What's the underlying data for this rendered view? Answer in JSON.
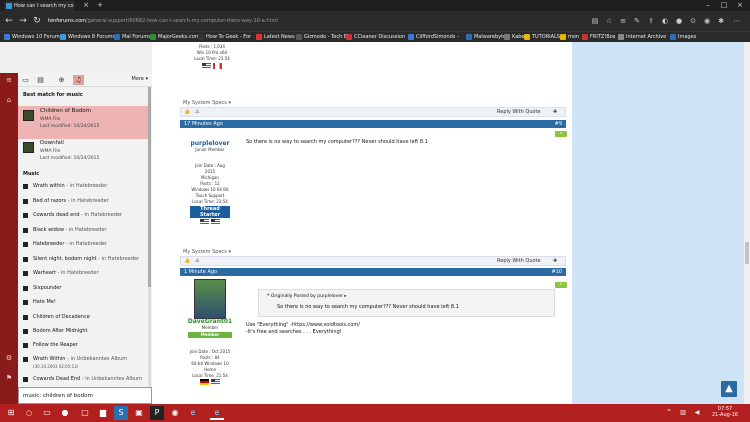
{
  "browser": {
    "tab_title": "How can I search my co",
    "url_domain": "tenforums.com",
    "url_path": "/general-support/60682-how-can-i-search-my-computer-there-way-10-a.html",
    "favorites": [
      {
        "label": "Windows 10 Forums",
        "color": "#3a7bd5"
      },
      {
        "label": "Windows 8 Forums",
        "color": "#3a9bdc"
      },
      {
        "label": "Mal Forums",
        "color": "#2a6fb0"
      },
      {
        "label": "MajorGeeks.com",
        "color": "#2f8f2f"
      },
      {
        "label": "How To Geek - For",
        "color": "#333333"
      },
      {
        "label": "Latest News",
        "color": "#d33"
      },
      {
        "label": "Gizmodo - Tech By",
        "color": "#555"
      },
      {
        "label": "CCleaner Discussion",
        "color": "#c33"
      },
      {
        "label": "CliffordSimonds -",
        "color": "#3a7bd5"
      },
      {
        "label": "Malwarebytes",
        "color": "#2a6fb0"
      },
      {
        "label": "Kabel",
        "color": "#777"
      },
      {
        "label": "TUTORIALS",
        "color": "#e6b800"
      },
      {
        "label": "mon",
        "color": "#e6b800"
      },
      {
        "label": "FRITZ!Box",
        "color": "#c33"
      },
      {
        "label": "Internet Archive",
        "color": "#888"
      },
      {
        "label": "Images",
        "color": "#2a6fb0"
      }
    ]
  },
  "start_menu": {
    "more_label": "More",
    "best_match_heading": "Best match for music",
    "best_matches": [
      {
        "title": "Children of Bodom",
        "type": "WMA File",
        "modified": "Last modified: 10/24/2015",
        "selected": true
      },
      {
        "title": "Downfall",
        "type": "WMA File",
        "modified": "Last modified: 10/24/2015",
        "selected": false
      }
    ],
    "music_heading": "Music",
    "music_items": [
      {
        "title": "Wrath within",
        "album": " - in Hatebreeder"
      },
      {
        "title": "Bed of razors",
        "album": " - in Hatebreeder"
      },
      {
        "title": "Cowards dead end",
        "album": " - in Hatebreeder"
      },
      {
        "title": "Black widow",
        "album": " - in Hatebreeder"
      },
      {
        "title": "Hatebreeder",
        "album": " - in Hatebreeder"
      },
      {
        "title": "Silent night, bodom night",
        "album": " - in Hatebreeder"
      },
      {
        "title": "Warheart",
        "album": " - in Hatebreeder"
      },
      {
        "title": "Sixpounder",
        "album": ""
      },
      {
        "title": "Hate Me!",
        "album": ""
      },
      {
        "title": "Children of Decadence",
        "album": ""
      },
      {
        "title": "Bodom After Midnight",
        "album": ""
      },
      {
        "title": "Follow the Reaper",
        "album": ""
      },
      {
        "title": "Wrath Within",
        "album": " - in Unbekanntes Album"
      },
      {
        "title": "Cowards Dead End",
        "album": " - in Unbekanntes Album"
      }
    ],
    "music_item_dates": [
      "(30.10.2003 02:05:13)"
    ],
    "search_value": "music: children of bodom"
  },
  "forum": {
    "top_user": {
      "posts": "Posts : 1,034",
      "os": "Win 10 Pro x64",
      "local_time": "Local Time: 23:54"
    },
    "specs_label": "My System Specs",
    "reply_label": "Reply With Quote",
    "post9": {
      "time": "17 Minutes Ago",
      "number": "#9",
      "username": "purplelover",
      "title": "Junior Member",
      "join": "Join Date : Aug 2015",
      "location": "Michigan",
      "posts": "Posts : 12",
      "os": "Windows 10 64 Bit Touch Support",
      "local_time": "Local Time: 23:54",
      "badge": "Thread Starter",
      "text": "So there is no way to search my computer??? Never should have left 8.1"
    },
    "post10": {
      "time": "1 Minute Ago",
      "number": "#10",
      "username": "DaveGrant01",
      "title": "Member",
      "rank": "Member",
      "join": "Join Date : Oct 2015",
      "posts": "Posts : 84",
      "os": "64-bit Windows 10 Home",
      "local_time": "Local Time: 21:54",
      "quote_by": "Originally Posted by purplelover",
      "quote_text": "So there is no way to search my computer??? Never should have left 8.1",
      "line1": "Use \"Everything\" -https://www.voidtools.com/",
      "line2": "-It's free and searches . . . Everything!"
    }
  },
  "taskbar": {
    "time": "07:57",
    "date": "21-Aug-16"
  }
}
